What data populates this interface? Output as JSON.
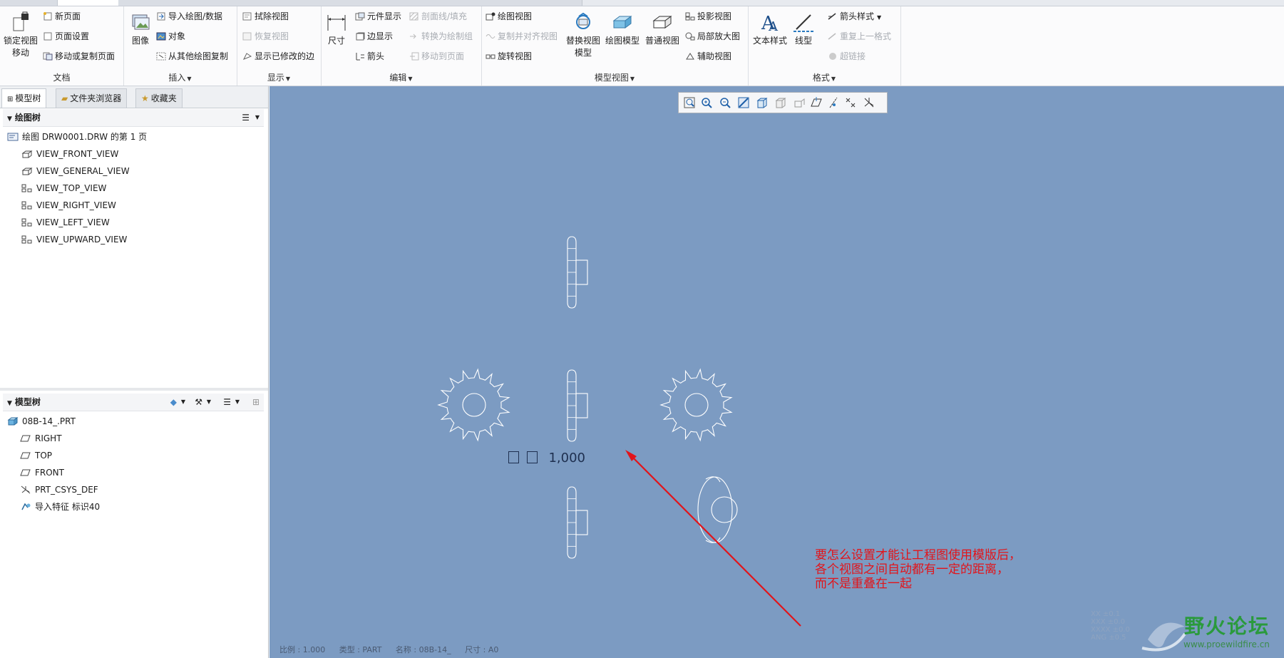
{
  "ribbon": {
    "groups": [
      {
        "name": "文档",
        "buttons": {
          "lock_view_move": "锁定视图\n移动",
          "new_page": "新页面",
          "page_setup": "页面设置",
          "move_copy_page": "移动或复制页面"
        }
      },
      {
        "name": "插入",
        "buttons": {
          "image": "图像",
          "import_drawing": "导入绘图/数据",
          "object": "对象",
          "copy_from_other": "从其他绘图复制"
        }
      },
      {
        "name": "显示",
        "buttons": {
          "erase_view": "拭除视图",
          "restore_view": "恢复视图",
          "show_modified_edges": "显示已修改的边"
        }
      },
      {
        "name": "编辑",
        "buttons": {
          "dimension": "尺寸",
          "element_display": "元件显示",
          "edge_display": "边显示",
          "arrow": "箭头",
          "hatch_fill": "剖面线/填充",
          "convert_to_group": "转换为绘制组",
          "move_to_page": "移动到页面"
        }
      },
      {
        "name": "模型视图",
        "buttons": {
          "drawing_view": "绘图视图",
          "copy_align_view": "复制并对齐视图",
          "rotate_view": "旋转视图",
          "replace_view_model": "替换视图\n模型",
          "drawing_model": "绘图模型",
          "general_view": "普通视图",
          "projection_view": "投影视图",
          "detailed_view": "局部放大图",
          "auxiliary_view": "辅助视图"
        }
      },
      {
        "name": "格式",
        "buttons": {
          "text_style": "文本样式",
          "line_style": "线型",
          "arrow_style": "箭头样式",
          "repeat_last_format": "重复上一格式",
          "hyperlink": "超链接"
        }
      }
    ]
  },
  "panel": {
    "tabs": [
      "模型树",
      "文件夹浏览器",
      "收藏夹"
    ],
    "drawing_tree": {
      "title": "绘图树",
      "items": [
        "绘图 DRW0001.DRW 的第 1 页",
        "VIEW_FRONT_VIEW",
        "VIEW_GENERAL_VIEW",
        "VIEW_TOP_VIEW",
        "VIEW_RIGHT_VIEW",
        "VIEW_LEFT_VIEW",
        "VIEW_UPWARD_VIEW"
      ]
    },
    "model_tree": {
      "title": "模型树",
      "items": [
        "08B-14_.PRT",
        "RIGHT",
        "TOP",
        "FRONT",
        "PRT_CSYS_DEF",
        "导入特征 标识40"
      ]
    }
  },
  "canvas": {
    "scale_value": "1,000",
    "note_lines": [
      "要怎么设置才能让工程图使用模版后，",
      "各个视图之间自动都有一定的距离，",
      "而不是重叠在一起"
    ],
    "status": {
      "scale": "比例 : 1.000",
      "type": "类型 : PART",
      "name": "名称 : 08B-14_",
      "size": "尺寸 : A0"
    },
    "tolerance_lines": [
      "XX  ±0.1",
      "XXX  ±0.0",
      "XXXX  ±0.0",
      "ANG  ±0.5"
    ],
    "watermark_title": "野火论坛",
    "watermark_url": "www.proewildfire.cn"
  },
  "colors": {
    "canvas_bg": "#7c9bc2",
    "annotation": "#e2141a",
    "watermark": "#2a9a3c"
  }
}
